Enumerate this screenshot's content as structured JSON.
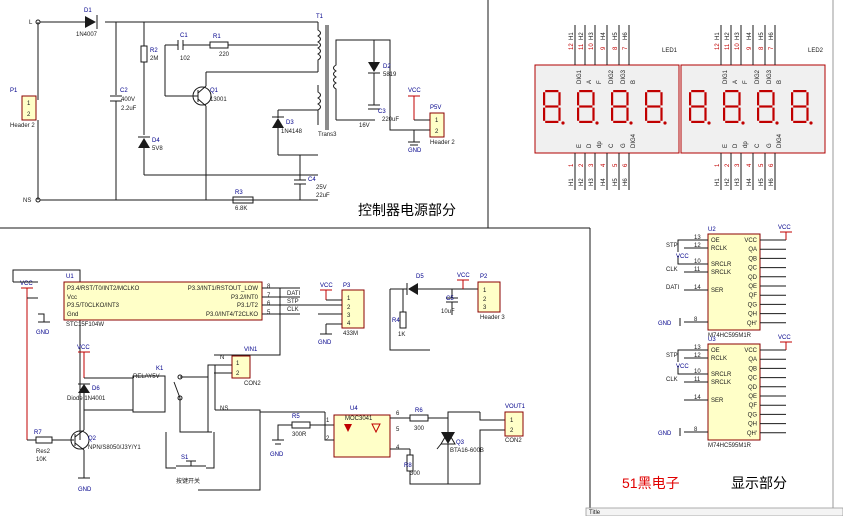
{
  "sections": {
    "power": "控制器电源部分",
    "brand": "51黑电子",
    "display": "显示部分",
    "title_block": "Title"
  },
  "power": {
    "L": "L",
    "N": "N",
    "NS": "NS",
    "P1": "P1",
    "P1_part": "Header 2",
    "D1": "D1",
    "D1_part": "1N4007",
    "C2": "C2",
    "C2_val1": "400V",
    "C2_val2": "2.2uF",
    "R2": "R2",
    "R2_val": "2M",
    "C1": "C1",
    "C1_val": "102",
    "R1": "R1",
    "R1_val": "220",
    "Q1": "Q1",
    "Q1_part": "13001",
    "D4": "D4",
    "D4_val": "5V8",
    "D3": "D3",
    "D3_part": "1N4148",
    "R3": "R3",
    "R3_val": "6.8K",
    "C4": "C4",
    "C4_val1": "25V",
    "C4_val2": "22uF",
    "T1": "T1",
    "T1_part": "Trans3",
    "D2": "D2",
    "D2_part": "5819",
    "C3": "C3",
    "C3_val1": "16V",
    "C3_val2": "220uF",
    "VCC": "VCC",
    "GND": "GND",
    "P5V": "P5V",
    "P5V_part": "Header 2"
  },
  "mcu": {
    "U1": "U1",
    "pins_left": [
      "P3.4/RST/T0/INT2/MCLKO",
      "Vcc",
      "P3.5/T0CLKO/INT3",
      "Gnd"
    ],
    "pins_right": [
      "P3.3/INT1/RSTOUT_LOW",
      "P3.2/INT0",
      "P3.1/T2",
      "P3.0/INT4/T2CLKO"
    ],
    "pin_nums_right": [
      "8",
      "7",
      "6",
      "5"
    ],
    "part": "STC15F104W",
    "nets_right": [
      "DATI",
      "STP",
      "CLK"
    ],
    "P3": "P3",
    "P3_part": "433M",
    "P3_pins": [
      "1",
      "2",
      "3",
      "4"
    ],
    "D5": "D5",
    "R4": "R4",
    "R4_val": "1K",
    "C5": "C5",
    "C5_val": "10uF",
    "P2": "P2",
    "P2_part": "Header 3",
    "P2_pins": [
      "1",
      "2",
      "3"
    ],
    "K1": "K1",
    "K1_part": "RELAY5V",
    "D6": "D6",
    "D6_part": "Diode 1N4001",
    "R7": "R7",
    "R7_part": "Res2",
    "R7_val": "10K",
    "Q2": "Q2",
    "Q2_part": "NPN/S8050/J3Y/Y1",
    "S1": "S1",
    "S1_part": "按键开关",
    "VIN1": "VIN1",
    "VIN1_part": "CON2",
    "N": "N",
    "NS": "NS",
    "R5": "R5",
    "R5_val": "300R",
    "U4": "U4",
    "U4_part": "MOC3041",
    "U4_pins": [
      "1",
      "2",
      "6",
      "5",
      "4"
    ],
    "R6": "R6",
    "R6_val": "300",
    "R8": "R8",
    "R8_val": "300",
    "Q3": "Q3",
    "Q3_part": "BTA16-600B",
    "VOUT1": "VOUT1",
    "VOUT1_part": "CON2"
  },
  "display": {
    "LED1": "LED1",
    "LED2": "LED2",
    "U2": "U2",
    "U3": "U3",
    "ic_part": "M74HC595M1R",
    "ic_left": [
      "OE",
      "RCLK",
      "SRCLR",
      "SRCLK",
      "SER"
    ],
    "ic_left_nums": [
      "13",
      "12",
      "10",
      "11",
      "14",
      "8"
    ],
    "ic_right": [
      "VCC",
      "QA",
      "QB",
      "QC",
      "QD",
      "QE",
      "QF",
      "QG",
      "QH",
      "QH'"
    ],
    "u2_nets": [
      "STP",
      "CLK",
      "DATI"
    ],
    "u3_nets": [
      "STP",
      "CLK"
    ],
    "led_top_pins": [
      "12",
      "11",
      "10",
      "9",
      "8",
      "7"
    ],
    "led_bottom_pins": [
      "1",
      "2",
      "3",
      "4",
      "5",
      "6"
    ],
    "led_top_labels": [
      "DIG1",
      "A",
      "F",
      "DIG2",
      "DIG3",
      "B"
    ],
    "led_bottom_labels": [
      "E",
      "D",
      "dp",
      "C",
      "G",
      "DIG4"
    ],
    "led_top_nets": [
      "H1",
      "H2",
      "H3",
      "H4",
      "H5",
      "H6"
    ],
    "led_bottom_nets": [
      "H1",
      "H2",
      "H3",
      "H4",
      "H5",
      "H6"
    ],
    "dp": "dp"
  }
}
